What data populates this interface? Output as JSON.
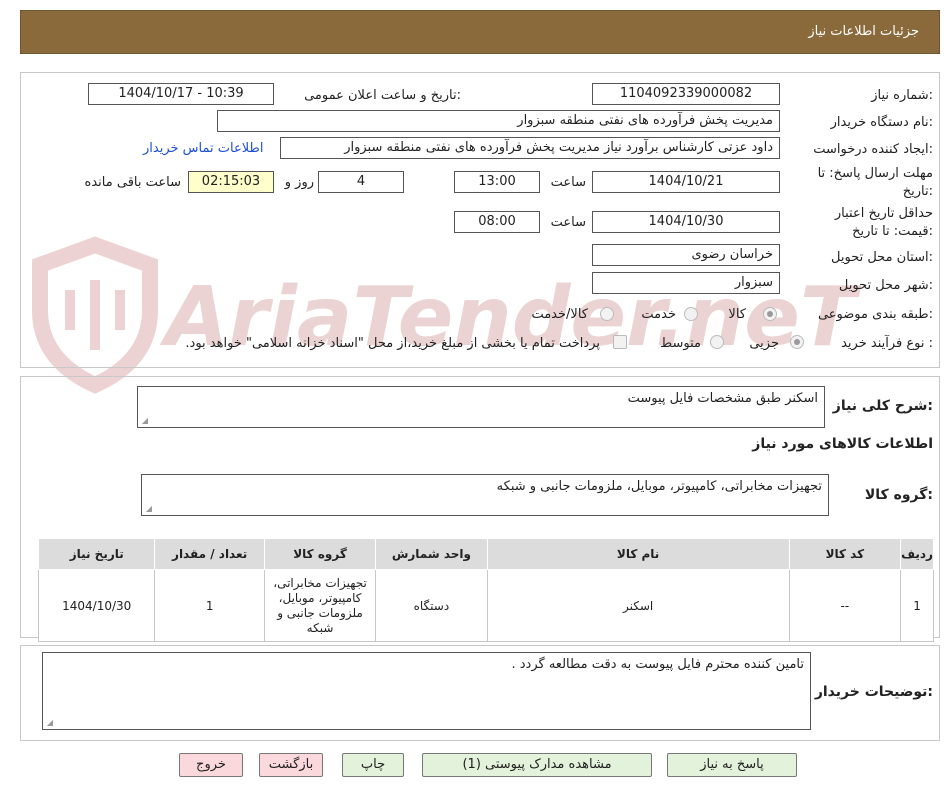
{
  "header": {
    "title": "جزئیات اطلاعات نیاز"
  },
  "fields": {
    "need_number": {
      "label": "شماره نیاز:",
      "value": "1104092339000082"
    },
    "announce": {
      "label": "تاریخ و ساعت اعلان عمومی:",
      "value": "1404/10/17 - 10:39"
    },
    "buyer_org": {
      "label": "نام دستگاه خریدار:",
      "value": "مدیریت پخش فرآورده های نفتی منطقه سبزوار"
    },
    "creator": {
      "label": "ایجاد کننده درخواست:",
      "value": "داود عزتی کارشناس برآورد نیاز مدیریت پخش فرآورده های نفتی منطقه سبزوار",
      "contact_link": "اطلاعات تماس خریدار"
    },
    "deadline": {
      "label_line1": "مهلت ارسال پاسخ: تا",
      "label_line2": "تاریخ:",
      "date": "1404/10/21",
      "time_label": "ساعت",
      "time": "13:00",
      "days": "4",
      "days_label": "روز و",
      "remaining": "02:15:03",
      "remaining_label": "ساعت باقی مانده"
    },
    "validity": {
      "label_line1": "حداقل تاریخ اعتبار",
      "label_line2": "قیمت: تا تاریخ:",
      "date": "1404/10/30",
      "time_label": "ساعت",
      "time": "08:00"
    },
    "province": {
      "label": "استان محل تحویل:",
      "value": "خراسان رضوی"
    },
    "city": {
      "label": "شهر محل تحویل:",
      "value": "سبزوار"
    },
    "category": {
      "label": "طبقه بندی موضوعی:",
      "options": [
        "کالا",
        "خدمت",
        "کالا/خدمت"
      ],
      "selected": "کالا"
    },
    "process": {
      "label": "نوع فرآیند خرید :",
      "options": [
        "جزیی",
        "متوسط"
      ],
      "selected": "جزیی",
      "checkbox_text": "پرداخت تمام یا بخشی از مبلغ خرید،از محل \"اسناد خزانه اسلامی\" خواهد بود."
    }
  },
  "description": {
    "label": "شرح کلی نیاز:",
    "value": "اسکنر  طبق مشخصات فایل پیوست"
  },
  "goods_info": {
    "title": "اطلاعات کالاهای مورد نیاز"
  },
  "goods_group": {
    "label": "گروه کالا:",
    "value": "تجهیزات مخابراتی، کامپیوتر، موبایل، ملزومات جانبی و شبکه"
  },
  "table": {
    "columns": [
      "ردیف",
      "کد کالا",
      "نام کالا",
      "واحد شمارش",
      "گروه کالا",
      "تعداد / مقدار",
      "تاریخ نیاز"
    ],
    "rows": [
      {
        "row": "1",
        "code": "--",
        "name": "اسکنر",
        "unit": "دستگاه",
        "group": "تجهیزات مخابراتی، کامپیوتر، موبایل، ملزومات جانبی و شبکه",
        "qty": "1",
        "date": "1404/10/30"
      }
    ]
  },
  "buyer_notes": {
    "label": "توضیحات خریدار:",
    "value": "تامین کننده محترم فایل پیوست به دقت مطالعه گردد ."
  },
  "buttons": {
    "reply": "پاسخ به نیاز",
    "attachments": "مشاهده مدارک پیوستی (1)",
    "print": "چاپ",
    "back": "بازگشت",
    "exit": "خروج"
  },
  "watermark": {
    "text": "AriaTender.neT",
    "color": "#e8c9c9"
  },
  "colors": {
    "header_bg": "#8a6a3b",
    "link": "#1d4fd8",
    "green_button": "#e3f2da",
    "pink_button": "#fad8dc"
  }
}
